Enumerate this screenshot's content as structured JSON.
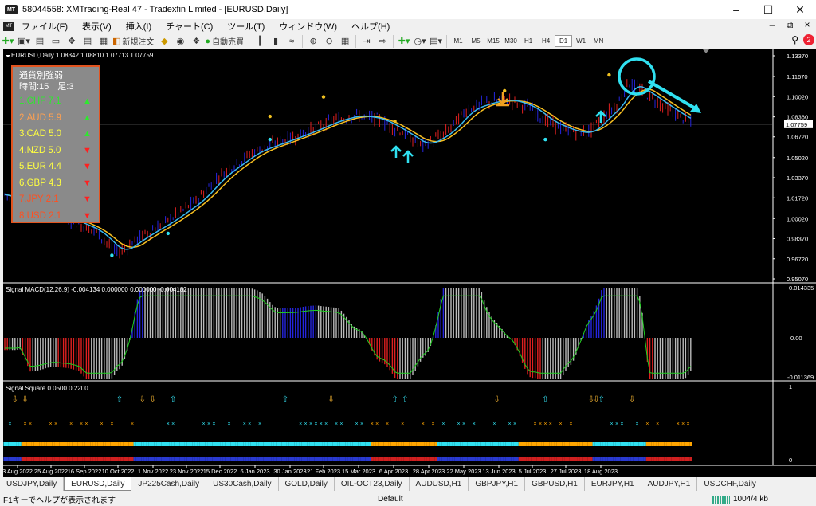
{
  "window": {
    "title": "58044558: XMTrading-Real 47 - Tradexfin Limited - [EURUSD,Daily]",
    "logo": "MT",
    "controls": [
      "minimize-icon",
      "maximize-icon",
      "close-icon"
    ]
  },
  "menu": {
    "items": [
      "ファイル(F)",
      "表示(V)",
      "挿入(I)",
      "チャート(C)",
      "ツール(T)",
      "ウィンドウ(W)",
      "ヘルプ(H)"
    ]
  },
  "toolbar": {
    "new_order": "新規注文",
    "auto_trade": "自動売買",
    "timeframes": [
      "M1",
      "M5",
      "M15",
      "M30",
      "H1",
      "H4",
      "D1",
      "W1",
      "MN"
    ],
    "active_timeframe": "D1",
    "notifications": "2"
  },
  "chart": {
    "header": "EURUSD,Daily  1.08342 1.08810 1.07713 1.07759",
    "price_labels": [
      "1.13370",
      "1.11670",
      "1.10020",
      "1.08360",
      "1.06720",
      "1.05020",
      "1.03370",
      "1.01720",
      "1.00020",
      "0.98370",
      "0.96720",
      "0.95070"
    ],
    "current_price": "1.07759",
    "dates": [
      "3 Aug 2022",
      "25 Aug 2022",
      "16 Sep 2022",
      "10 Oct 2022",
      "1 Nov 2022",
      "23 Nov 2022",
      "15 Dec 2022",
      "6 Jan 2023",
      "30 Jan 2023",
      "21 Feb 2023",
      "15 Mar 2023",
      "6 Apr 2023",
      "28 Apr 2023",
      "22 May 2023",
      "13 Jun 2023",
      "5 Jul 2023",
      "27 Jul 2023",
      "18 Aug 2023"
    ],
    "macd_header": "Signal MACD(12,26,9) -0.004134 0.000000 0.000000 -0.004182",
    "macd_labels": [
      "0.014335",
      "0.00",
      "-0.011369"
    ],
    "square_header": "Signal Square 0.0500 0.2200",
    "square_labels": [
      "1",
      "0"
    ]
  },
  "strength": {
    "title_line1": "通貨別強弱",
    "title_line2": "時間:15　足:3",
    "rows": [
      {
        "label": "1.CHF  7.1",
        "color": "#2ee82e",
        "arrow": "▲",
        "arrow_color": "#2ee82e"
      },
      {
        "label": "2.AUD  5.9",
        "color": "#ffa050",
        "arrow": "▲",
        "arrow_color": "#2ee82e"
      },
      {
        "label": "3.CAD  5.0",
        "color": "#ffff40",
        "arrow": "▲",
        "arrow_color": "#2ee82e"
      },
      {
        "label": "4.NZD  5.0",
        "color": "#ffff40",
        "arrow": "▼",
        "arrow_color": "#ff2020"
      },
      {
        "label": "5.EUR  4.4",
        "color": "#ffff40",
        "arrow": "▼",
        "arrow_color": "#ff2020"
      },
      {
        "label": "6.GBP  4.3",
        "color": "#ffff40",
        "arrow": "▼",
        "arrow_color": "#ff2020"
      },
      {
        "label": "7.JPY   2.1",
        "color": "#ff5020",
        "arrow": "▼",
        "arrow_color": "#ff2020"
      },
      {
        "label": "8.USD  2.1",
        "color": "#ff5020",
        "arrow": "▼",
        "arrow_color": "#ff2020"
      }
    ]
  },
  "tabs": [
    "USDJPY,Daily",
    "EURUSD,Daily",
    "JP225Cash,Daily",
    "US30Cash,Daily",
    "GOLD,Daily",
    "OIL-OCT23,Daily",
    "AUDUSD,H1",
    "GBPJPY,H1",
    "GBPUSD,H1",
    "EURJPY,H1",
    "AUDJPY,H1",
    "USDCHF,Daily"
  ],
  "active_tab": "EURUSD,Daily",
  "status": {
    "help": "F1キーでヘルプが表示されます",
    "profile": "Default",
    "traffic": "1004/4 kb"
  },
  "colors": {
    "bull": "#2525e0",
    "bear": "#e02020",
    "ma_fast": "#38b8f0",
    "ma_slow": "#f8c020",
    "macd_signal": "#20d020",
    "accent_cyan": "#30e0f0",
    "accent_orange": "#f0a020"
  }
}
